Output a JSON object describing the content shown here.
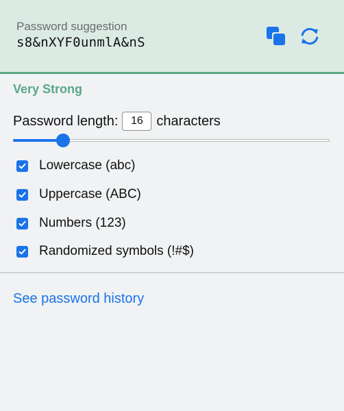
{
  "header": {
    "label": "Password suggestion",
    "password": "s8&nXYF0unmlA&nS",
    "copy_icon": "copy-icon",
    "refresh_icon": "refresh-icon"
  },
  "strength": {
    "label": "Very Strong",
    "color": "#5aa887"
  },
  "length": {
    "label": "Password length:",
    "value": "16",
    "unit": "characters",
    "min": 8,
    "max": 64,
    "current": 16
  },
  "options": [
    {
      "label": "Lowercase (abc)",
      "checked": true
    },
    {
      "label": "Uppercase (ABC)",
      "checked": true
    },
    {
      "label": "Numbers (123)",
      "checked": true
    },
    {
      "label": "Randomized symbols (!#$)",
      "checked": true
    }
  ],
  "history": {
    "link_label": "See password history"
  },
  "colors": {
    "accent": "#1a73e8",
    "header_bg": "#dceae4",
    "success": "#5aa887"
  }
}
